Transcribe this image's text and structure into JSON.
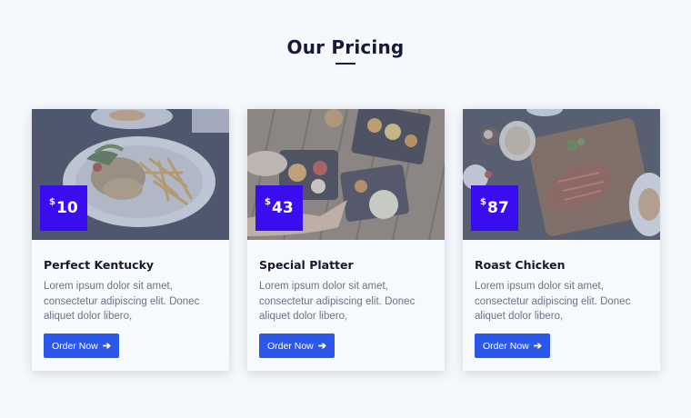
{
  "section": {
    "title": "Our Pricing"
  },
  "colors": {
    "accent_badge": "#3a0df0",
    "button": "#2b58e8",
    "title": "#141a38"
  },
  "cards": [
    {
      "image": "fried-chicken-fries-plate-photo",
      "currency": "$",
      "price": "10",
      "title": "Perfect Kentucky",
      "description": "Lorem ipsum dolor sit amet, consectetur adipiscing elit. Donec aliquet dolor libero,",
      "button_label": "Order Now",
      "button_icon": "arrow-right-icon"
    },
    {
      "image": "party-platter-table-photo",
      "currency": "$",
      "price": "43",
      "title": "Special Platter",
      "description": "Lorem ipsum dolor sit amet, consectetur adipiscing elit. Donec aliquet dolor libero,",
      "button_label": "Order Now",
      "button_icon": "arrow-right-icon"
    },
    {
      "image": "roast-chicken-board-photo",
      "currency": "$",
      "price": "87",
      "title": "Roast Chicken",
      "description": "Lorem ipsum dolor sit amet, consectetur adipiscing elit. Donec aliquet dolor libero,",
      "button_label": "Order Now",
      "button_icon": "arrow-right-icon"
    }
  ]
}
